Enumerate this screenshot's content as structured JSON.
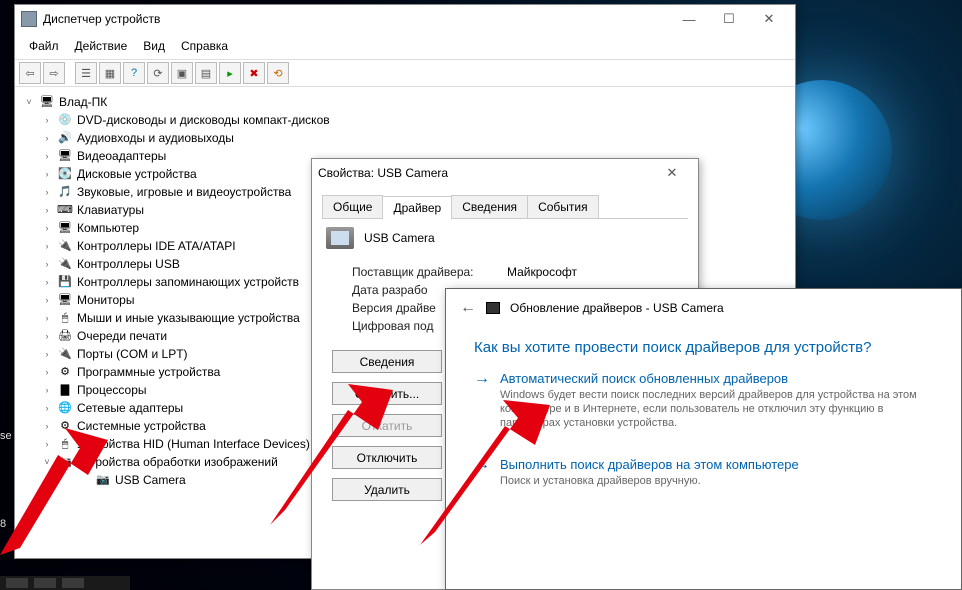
{
  "devmgr": {
    "title": "Диспетчер устройств",
    "menu": [
      "Файл",
      "Действие",
      "Вид",
      "Справка"
    ],
    "root": "Влад-ПК",
    "categories": [
      "DVD-дисководы и дисководы компакт-дисков",
      "Аудиовходы и аудиовыходы",
      "Видеоадаптеры",
      "Дисковые устройства",
      "Звуковые, игровые и видеоустройства",
      "Клавиатуры",
      "Компьютер",
      "Контроллеры IDE ATA/ATAPI",
      "Контроллеры USB",
      "Контроллеры запоминающих устройств",
      "Мониторы",
      "Мыши и иные указывающие устройства",
      "Очереди печати",
      "Порты (COM и LPT)",
      "Программные устройства",
      "Процессоры",
      "Сетевые адаптеры",
      "Системные устройства",
      "Устройства HID (Human Interface Devices)",
      "Устройства обработки изображений"
    ],
    "child": "USB Camera"
  },
  "props": {
    "title": "Свойства: USB Camera",
    "tabs": [
      "Общие",
      "Драйвер",
      "Сведения",
      "События"
    ],
    "device": "USB Camera",
    "rows": {
      "provider_k": "Поставщик драйвера:",
      "provider_v": "Майкрософт",
      "date_k": "Дата разрабо",
      "ver_k": "Версия драйве",
      "sig_k": "Цифровая под"
    },
    "buttons": {
      "details": "Сведения",
      "update": "Обновить...",
      "rollback": "Откатить",
      "disable": "Отключить",
      "delete": "Удалить"
    }
  },
  "wizard": {
    "title": "Обновление драйверов - USB Camera",
    "question": "Как вы хотите провести поиск драйверов для устройств?",
    "opt1": {
      "title": "Автоматический поиск обновленных драйверов",
      "sub": "Windows будет вести поиск последних версий драйверов для устройства на этом компьютере и в Интернете, если пользователь не отключил эту функцию в параметрах установки устройства."
    },
    "opt2": {
      "title": "Выполнить поиск драйверов на этом компьютере",
      "sub": "Поиск и установка драйверов вручную."
    }
  },
  "leftfrag": {
    "a": "se",
    "b": "8"
  }
}
